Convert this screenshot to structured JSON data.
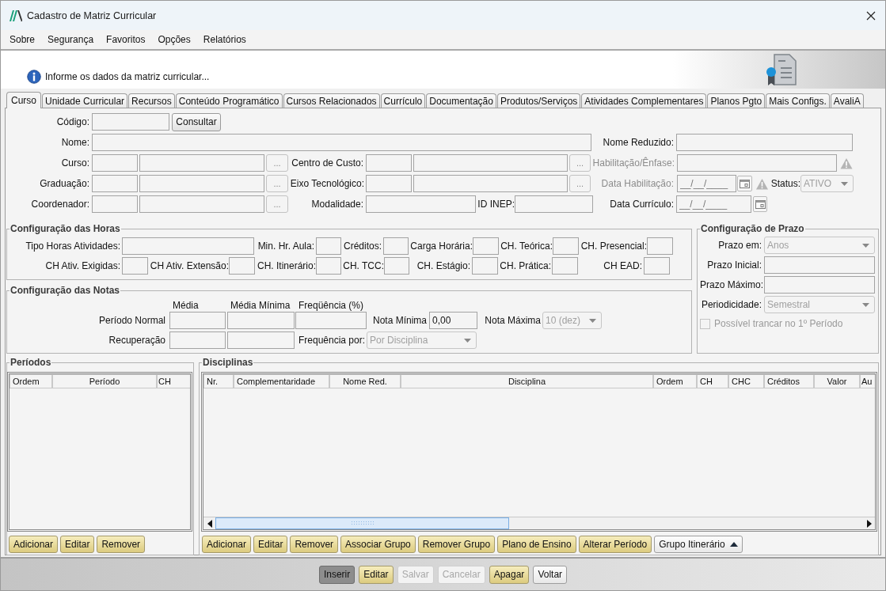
{
  "window": {
    "title": "Cadastro de Matriz Curricular"
  },
  "menu": [
    {
      "label": "Sobre"
    },
    {
      "label": "Segurança"
    },
    {
      "label": "Favoritos"
    },
    {
      "label": "Opções"
    },
    {
      "label": "Relatórios"
    }
  ],
  "info": "Informe os dados da matriz curricular...",
  "tabs": [
    {
      "label": "Curso",
      "selected": true
    },
    {
      "label": "Unidade Curricular",
      "selected": false
    },
    {
      "label": "Recursos",
      "selected": false
    },
    {
      "label": "Conteúdo Programático",
      "selected": false
    },
    {
      "label": "Cursos Relacionados",
      "selected": false
    },
    {
      "label": "Currículo",
      "selected": false
    },
    {
      "label": "Documentação",
      "selected": false
    },
    {
      "label": "Produtos/Serviços",
      "selected": false
    },
    {
      "label": "Atividades Complementares",
      "selected": false
    },
    {
      "label": "Planos Pgto",
      "selected": false
    },
    {
      "label": "Mais Configs.",
      "selected": false
    },
    {
      "label": "AvaliA",
      "selected": false
    }
  ],
  "main_rows": [
    [
      {
        "kind": "label",
        "text": "Código:"
      },
      {
        "kind": "field"
      },
      {
        "kind": "button",
        "text": "Consultar"
      }
    ],
    [
      {
        "kind": "label",
        "text": "Nome:"
      },
      {
        "kind": "field"
      },
      {
        "kind": "label",
        "text": "Nome Reduzido:"
      },
      {
        "kind": "field"
      }
    ],
    [
      {
        "kind": "label",
        "text": "Curso:"
      },
      {
        "kind": "field"
      },
      {
        "kind": "field"
      },
      {
        "kind": "lookup",
        "text": "..."
      },
      {
        "kind": "label",
        "text": "Centro de Custo:"
      },
      {
        "kind": "field"
      },
      {
        "kind": "field"
      },
      {
        "kind": "lookup",
        "text": "..."
      },
      {
        "kind": "label",
        "text": "Habilitação/Ênfase:",
        "disabled": true
      },
      {
        "kind": "field"
      },
      {
        "kind": "warning"
      }
    ],
    [
      {
        "kind": "label",
        "text": "Graduação:"
      },
      {
        "kind": "field"
      },
      {
        "kind": "field"
      },
      {
        "kind": "lookup",
        "text": "..."
      },
      {
        "kind": "label",
        "text": "Eixo Tecnológico:"
      },
      {
        "kind": "field"
      },
      {
        "kind": "field"
      },
      {
        "kind": "lookup",
        "text": "..."
      },
      {
        "kind": "label",
        "text": "Data Habilitação:",
        "disabled": true
      },
      {
        "kind": "date",
        "placeholder": "__/__/____"
      },
      {
        "kind": "calendar"
      },
      {
        "kind": "warning"
      },
      {
        "kind": "label",
        "text": "Status:"
      },
      {
        "kind": "select",
        "value": "ATIVO",
        "disabled": true
      }
    ],
    [
      {
        "kind": "label",
        "text": "Coordenador:"
      },
      {
        "kind": "field"
      },
      {
        "kind": "field"
      },
      {
        "kind": "lookup",
        "text": "..."
      },
      {
        "kind": "label",
        "text": "Modalidade:"
      },
      {
        "kind": "field"
      },
      {
        "kind": "label",
        "text": "ID INEP:"
      },
      {
        "kind": "field"
      },
      {
        "kind": "label",
        "text": "Data Currículo:"
      },
      {
        "kind": "date",
        "placeholder": "__/__/____"
      },
      {
        "kind": "calendar"
      }
    ]
  ],
  "hours": {
    "title": "Configuração das Horas",
    "fields": [
      {
        "label": "Tipo Horas Atividades:"
      },
      {
        "label": "Min. Hr. Aula:"
      },
      {
        "label": "Créditos:"
      },
      {
        "label": "Carga Horária:"
      },
      {
        "label": "CH. Teórica:"
      },
      {
        "label": "CH. Presencial:"
      },
      {
        "label": "CH Ativ. Exigidas:"
      },
      {
        "label": "CH Ativ. Extensão:"
      },
      {
        "label": "CH. Itinerário:"
      },
      {
        "label": "CH. TCC:"
      },
      {
        "label": "CH. Estágio:"
      },
      {
        "label": "CH. Prática:"
      },
      {
        "label": "CH EAD:"
      }
    ]
  },
  "grades": {
    "title": "Configuração das Notas",
    "rows": [
      [
        {
          "kind": "colhead",
          "text": "Média"
        },
        {
          "kind": "colhead",
          "text": "Média Mínima"
        },
        {
          "kind": "colhead",
          "text": "Freqüência (%)"
        }
      ],
      [
        {
          "kind": "label",
          "text": "Período Normal"
        },
        {
          "kind": "field"
        },
        {
          "kind": "field"
        },
        {
          "kind": "field"
        },
        {
          "kind": "label",
          "text": "Nota Mínima"
        },
        {
          "kind": "field",
          "value": "0,00"
        },
        {
          "kind": "label",
          "text": "Nota Máxima"
        },
        {
          "kind": "select",
          "value": "10 (dez)",
          "disabled": true
        }
      ],
      [
        {
          "kind": "label",
          "text": "Recuperação"
        },
        {
          "kind": "field"
        },
        {
          "kind": "field"
        },
        {
          "kind": "label",
          "text": "Frequência por:"
        },
        {
          "kind": "select",
          "value": "Por Disciplina",
          "disabled": true
        }
      ]
    ]
  },
  "term": {
    "title": "Configuração de Prazo",
    "rows": [
      [
        {
          "kind": "label",
          "text": "Prazo em:"
        },
        {
          "kind": "select",
          "value": "Anos",
          "disabled": true
        }
      ],
      [
        {
          "kind": "label",
          "text": "Prazo Inicial:"
        },
        {
          "kind": "field"
        }
      ],
      [
        {
          "kind": "label",
          "text": "Prazo Máximo:"
        },
        {
          "kind": "field"
        }
      ],
      [
        {
          "kind": "label",
          "text": "Periodicidade:"
        },
        {
          "kind": "select",
          "value": "Semestral",
          "disabled": true
        }
      ],
      [
        {
          "kind": "checkbox",
          "text": "Possível trancar no 1º Período",
          "checked": false,
          "disabled": true
        }
      ]
    ]
  },
  "periods": {
    "title": "Períodos",
    "columns": [
      "Ordem",
      "Período",
      "CH"
    ],
    "buttons": [
      {
        "text": "Adicionar",
        "highlighted": true
      },
      {
        "text": "Editar",
        "highlighted": true
      },
      {
        "text": "Remover",
        "highlighted": true
      }
    ]
  },
  "subjects": {
    "title": "Disciplinas",
    "columns": [
      "Nr.",
      "Complementaridade",
      "Nome Red.",
      "Disciplina",
      "Ordem",
      "CH",
      "CHC",
      "Créditos",
      "Valor",
      "Au"
    ],
    "buttons": [
      {
        "kind": "push",
        "text": "Adicionar",
        "highlighted": true
      },
      {
        "kind": "push",
        "text": "Editar",
        "highlighted": true
      },
      {
        "kind": "push",
        "text": "Remover",
        "highlighted": true
      },
      {
        "kind": "push",
        "text": "Associar Grupo",
        "highlighted": true
      },
      {
        "kind": "push",
        "text": "Remover Grupo",
        "highlighted": true
      },
      {
        "kind": "push",
        "text": "Plano de Ensino",
        "highlighted": true
      },
      {
        "kind": "push",
        "text": "Alterar Período",
        "highlighted": true
      },
      {
        "kind": "dropdown",
        "text": "Grupo Itinerário",
        "highlighted": false
      }
    ]
  },
  "actions": [
    {
      "text": "Inserir",
      "pressed": true,
      "highlighted": false,
      "disabled": false
    },
    {
      "text": "Editar",
      "pressed": false,
      "highlighted": true,
      "disabled": false
    },
    {
      "text": "Salvar",
      "pressed": false,
      "highlighted": false,
      "disabled": true
    },
    {
      "text": "Cancelar",
      "pressed": false,
      "highlighted": false,
      "disabled": true
    },
    {
      "text": "Apagar",
      "pressed": false,
      "highlighted": true,
      "disabled": false
    },
    {
      "text": "Voltar",
      "pressed": false,
      "highlighted": false,
      "disabled": false
    }
  ]
}
